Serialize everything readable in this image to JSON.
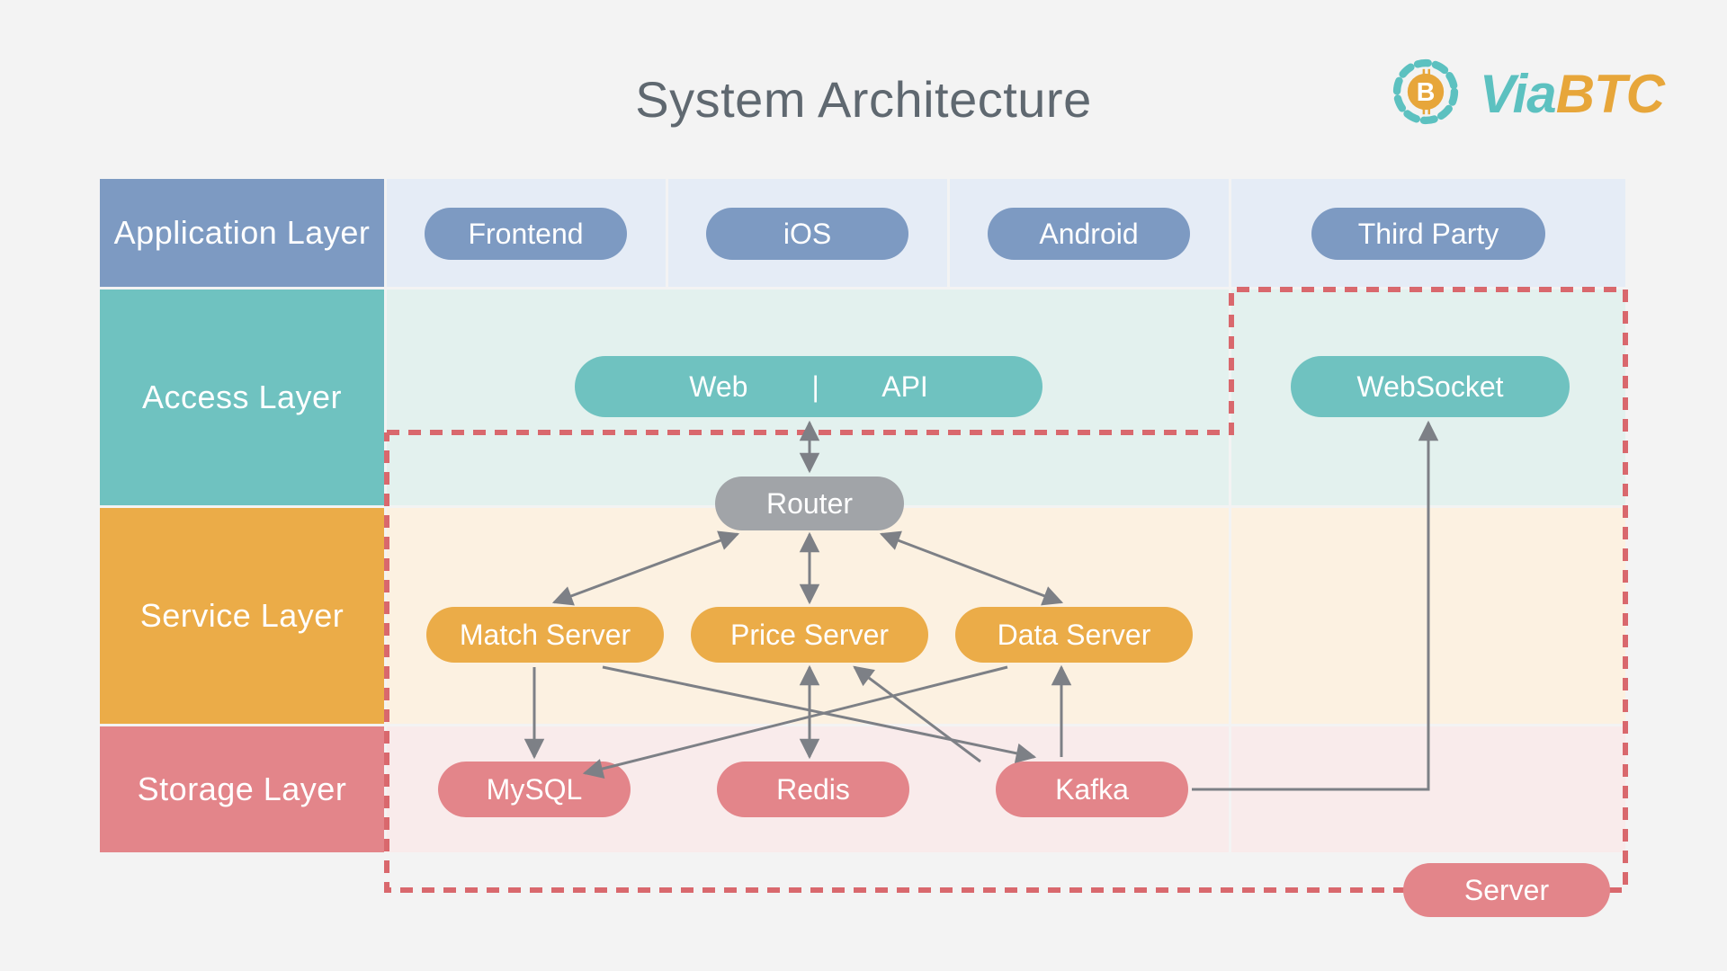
{
  "title": "System Architecture",
  "logo": {
    "via": "Via",
    "btc": "BTC"
  },
  "layers": {
    "application": {
      "label": "Application Layer",
      "items": [
        "Frontend",
        "iOS",
        "Android",
        "Third Party"
      ]
    },
    "access": {
      "label": "Access Layer",
      "webapi": "Web        |        API",
      "websocket": "WebSocket"
    },
    "service": {
      "label": "Service Layer",
      "router": "Router",
      "servers": [
        "Match Server",
        "Price Server",
        "Data Server"
      ]
    },
    "storage": {
      "label": "Storage Layer",
      "stores": [
        "MySQL",
        "Redis",
        "Kafka"
      ]
    }
  },
  "server_label": "Server",
  "colors": {
    "appLabel": "#7d9ac2",
    "appBg": "#e5ecf6",
    "accessLabel": "#6fc2c0",
    "accessBg": "#e3f1ee",
    "serviceLabel": "#ebac48",
    "serviceBg": "#fcf1e1",
    "storageLabel": "#e3858a",
    "storageBg": "#f9ebeb",
    "pillBlue": "#7d9ac2",
    "pillTeal": "#6fc2c0",
    "pillGrey": "#a1a4a8",
    "pillGold": "#ebac48",
    "pillRed": "#e3858a",
    "arrow": "#7d8086",
    "dash": "#d9686d"
  }
}
